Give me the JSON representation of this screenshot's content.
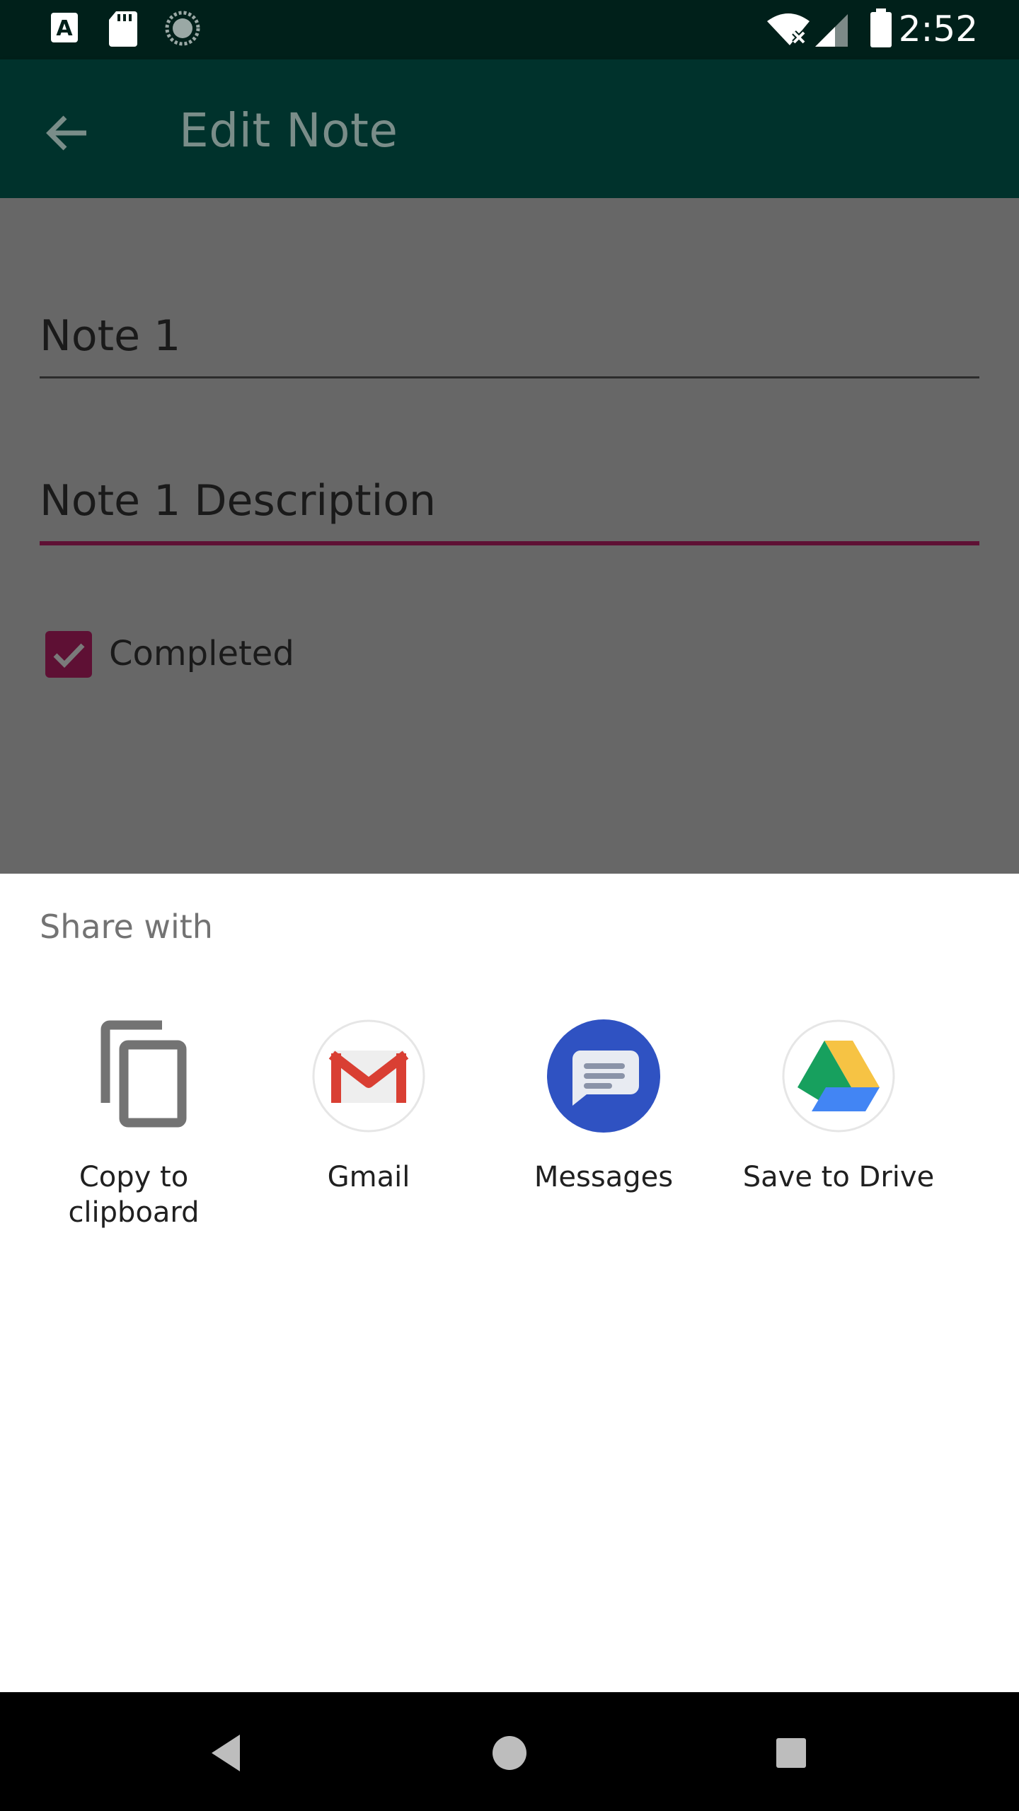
{
  "status_bar": {
    "time": "2:52",
    "left_icons": [
      "font-a-icon",
      "sd-card-icon",
      "sync-spinner-icon"
    ],
    "right_icons": [
      "wifi-off-icon",
      "cell-signal-icon",
      "battery-icon"
    ]
  },
  "app_bar": {
    "title": "Edit Note",
    "back_icon": "arrow-back-icon",
    "color": "#00322c"
  },
  "form": {
    "title_value": "Note 1",
    "description_value": "Note 1 Description",
    "completed_label": "Completed",
    "completed_checked": true,
    "accent_color": "#5e1034"
  },
  "share_sheet": {
    "title": "Share with",
    "targets": [
      {
        "label": "Copy to clipboard",
        "icon": "copy-icon"
      },
      {
        "label": "Gmail",
        "icon": "gmail-icon"
      },
      {
        "label": "Messages",
        "icon": "messages-icon"
      },
      {
        "label": "Save to Drive",
        "icon": "drive-icon"
      }
    ]
  },
  "nav_bar": {
    "buttons": [
      "back-triangle-icon",
      "home-circle-icon",
      "recents-square-icon"
    ]
  }
}
